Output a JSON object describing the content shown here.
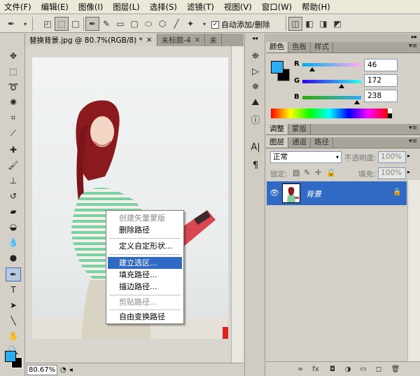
{
  "menu": [
    "文件(F)",
    "编辑(E)",
    "图像(I)",
    "图层(L)",
    "选择(S)",
    "滤镜(T)",
    "视图(V)",
    "窗口(W)",
    "帮助(H)"
  ],
  "options": {
    "auto_add_label": "自动添加/删除",
    "auto_add_checked": true
  },
  "tabs": [
    "替换背景.jpg @ 80.7%(RGB/8) *",
    "未标题-4",
    "未"
  ],
  "status": {
    "zoom": "80.67%"
  },
  "context_menu": [
    {
      "label": "创建矢量蒙版",
      "state": "disabled"
    },
    {
      "label": "删除路径",
      "state": "normal"
    },
    {
      "label": "定义自定形状...",
      "state": "normal"
    },
    {
      "label": "建立选区...",
      "state": "highlighted"
    },
    {
      "label": "填充路径...",
      "state": "normal"
    },
    {
      "label": "描边路径...",
      "state": "normal"
    },
    {
      "label": "剪贴路径...",
      "state": "disabled"
    },
    {
      "label": "自由变换路径",
      "state": "normal"
    }
  ],
  "color_panel": {
    "tabs": [
      "颜色",
      "色板",
      "样式"
    ],
    "r_label": "R",
    "g_label": "G",
    "b_label": "B",
    "r": "46",
    "g": "172",
    "b": "238",
    "foreground": "#2eacee",
    "background": "#000000"
  },
  "adjust_panel": {
    "tabs": [
      "调整",
      "蒙版"
    ]
  },
  "layers_panel": {
    "tabs": [
      "图层",
      "通道",
      "路径"
    ],
    "blend_mode": "正常",
    "opacity_label": "不透明度:",
    "opacity": "100%",
    "lock_label": "锁定:",
    "fill_label": "填充:",
    "fill": "100%",
    "layer_name": "背景"
  },
  "colors": {
    "accent": "#316ac5"
  }
}
